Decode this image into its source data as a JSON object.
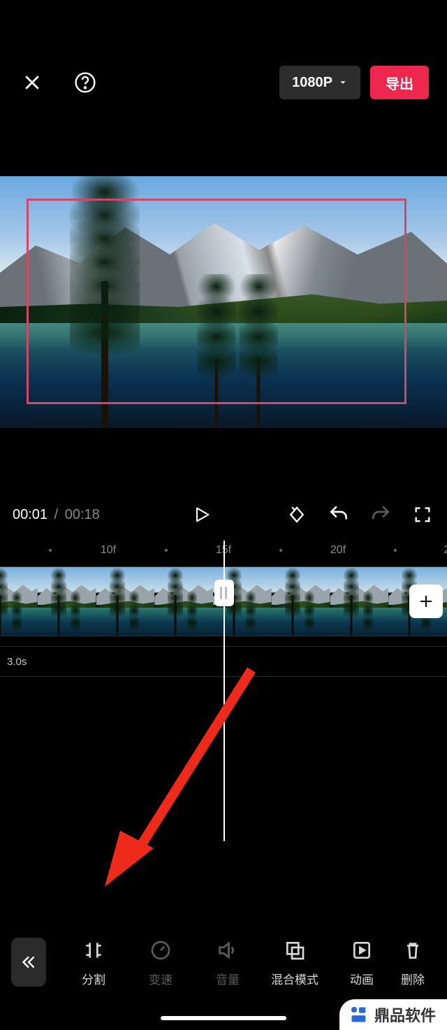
{
  "header": {
    "resolution": "1080P",
    "export_label": "导出"
  },
  "playback": {
    "current_time": "00:01",
    "separator": "/",
    "total_time": "00:18"
  },
  "ruler": {
    "labels": [
      "10f",
      "15f",
      "20f"
    ],
    "trailing": "2"
  },
  "subtrack": {
    "duration_label": "3.0s"
  },
  "tools": {
    "split": "分割",
    "speed": "变速",
    "volume": "音量",
    "blend": "混合模式",
    "animation": "动画",
    "delete": "删除"
  },
  "watermark": {
    "brand": "鼎品软件"
  },
  "colors": {
    "accent": "#ed274d",
    "frame": "#d04868"
  }
}
